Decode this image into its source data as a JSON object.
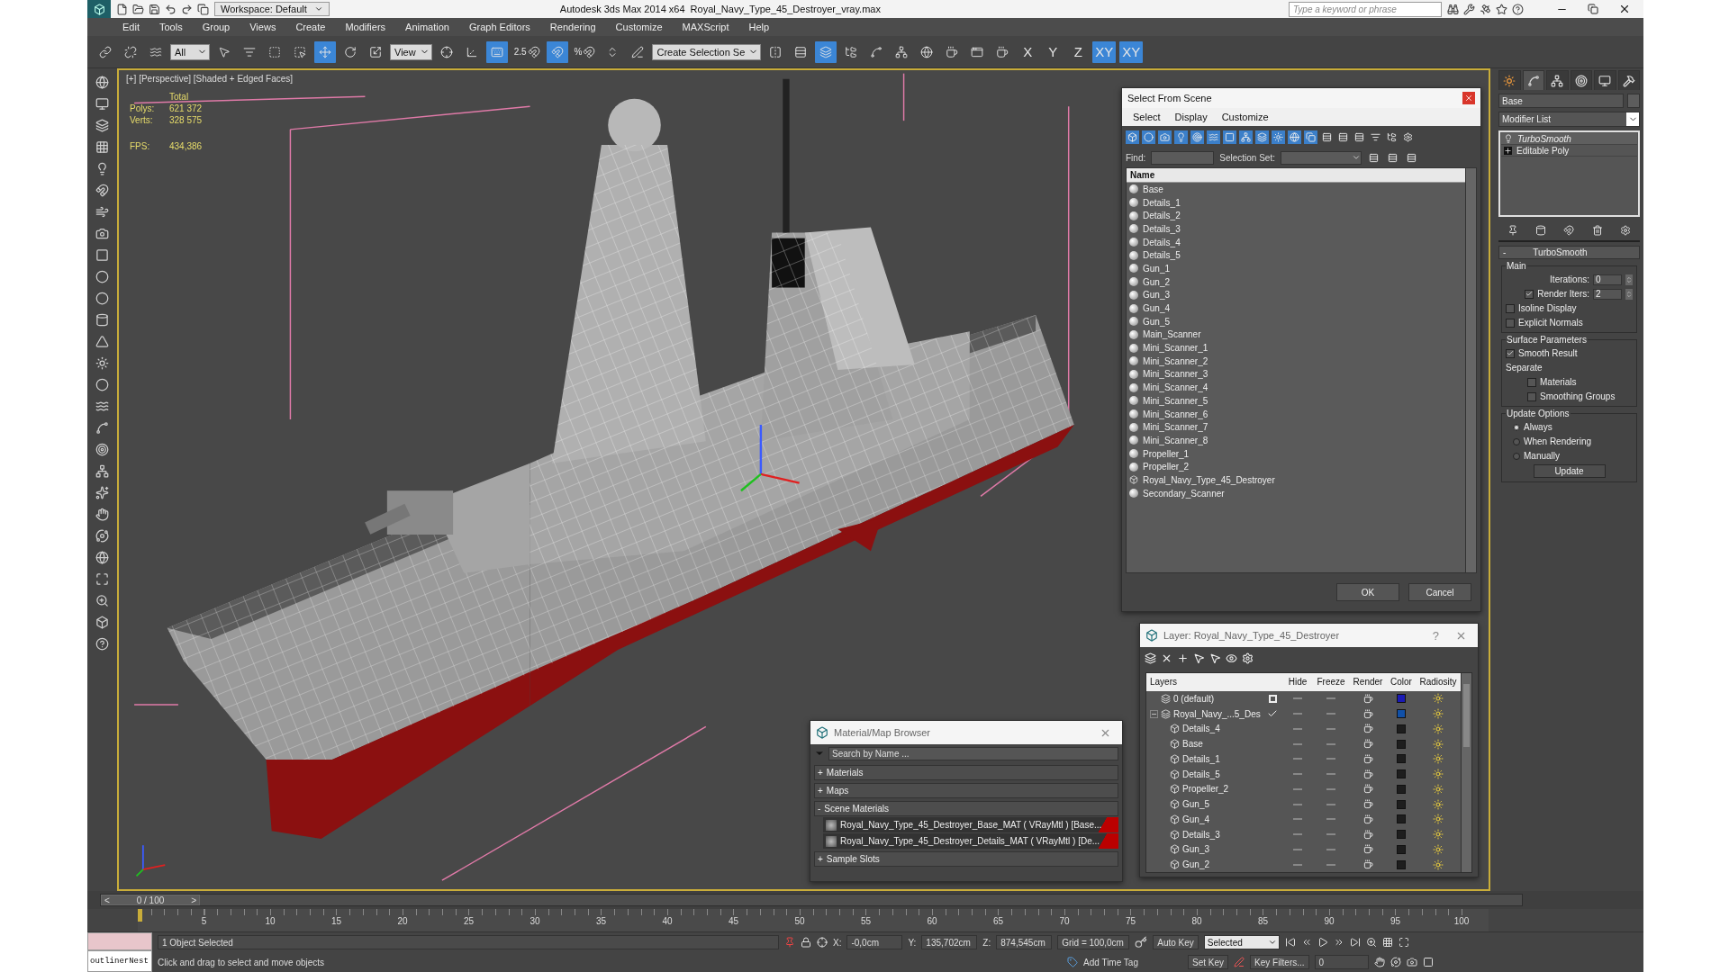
{
  "title_bar": {
    "workspace": "Workspace: Default",
    "app_title": "Autodesk 3ds Max  2014 x64",
    "file_name": "Royal_Navy_Type_45_Destroyer_vray.max",
    "search_placeholder": "Type a keyword or phrase"
  },
  "menu": [
    "Edit",
    "Tools",
    "Group",
    "Views",
    "Create",
    "Modifiers",
    "Animation",
    "Graph Editors",
    "Rendering",
    "Customize",
    "MAXScript",
    "Help"
  ],
  "toolbar": [
    {
      "kind": "link",
      "selected": false
    },
    {
      "kind": "unlink",
      "selected": false
    },
    {
      "kind": "bind",
      "selected": false
    },
    {
      "kind": "dropdown",
      "value": "All"
    },
    {
      "kind": "select",
      "selected": false
    },
    {
      "kind": "select-name",
      "selected": false
    },
    {
      "kind": "region",
      "selected": false
    },
    {
      "kind": "crossing",
      "selected": false
    },
    {
      "kind": "move",
      "selected": true
    },
    {
      "kind": "rotate",
      "selected": false
    },
    {
      "kind": "scale",
      "selected": false
    },
    {
      "kind": "dropdown",
      "value": "View"
    },
    {
      "kind": "pivot",
      "selected": false
    },
    {
      "kind": "manipulate",
      "selected": false
    },
    {
      "kind": "shortcut",
      "selected": true
    },
    {
      "kind": "snap",
      "label": "2.5",
      "selected": false
    },
    {
      "kind": "angle-snap",
      "selected": true
    },
    {
      "kind": "percent-snap",
      "label": "%",
      "selected": false
    },
    {
      "kind": "spinner-snap",
      "selected": false
    },
    {
      "kind": "named-sets",
      "selected": false
    },
    {
      "kind": "dropdown",
      "value": "Create Selection Se"
    },
    {
      "kind": "mirror",
      "selected": false
    },
    {
      "kind": "align",
      "selected": false
    },
    {
      "kind": "layers",
      "selected": true
    },
    {
      "kind": "scene",
      "selected": false
    },
    {
      "kind": "curve",
      "selected": false
    },
    {
      "kind": "schematic",
      "selected": false
    },
    {
      "kind": "material",
      "selected": false
    },
    {
      "kind": "render-setup",
      "selected": false
    },
    {
      "kind": "frame-window",
      "selected": false
    },
    {
      "kind": "render",
      "selected": false
    },
    {
      "kind": "axis",
      "label": "X",
      "selected": false
    },
    {
      "kind": "axis",
      "label": "Y",
      "selected": false
    },
    {
      "kind": "axis",
      "label": "Z",
      "selected": false
    },
    {
      "kind": "axis",
      "label": "XY",
      "selected": true
    },
    {
      "kind": "axis",
      "label": "XY",
      "selected": true
    }
  ],
  "viewport": {
    "label": "[+] [Perspective] [Shaded + Edged Faces]",
    "stats_title": "Total",
    "stats": [
      {
        "label": "Polys:",
        "value": "621 372"
      },
      {
        "label": "Verts:",
        "value": "328 575"
      }
    ],
    "fps": {
      "label": "FPS:",
      "value": "434,386"
    }
  },
  "select_from_scene": {
    "title": "Select From Scene",
    "menu": [
      "Select",
      "Display",
      "Customize"
    ],
    "find_label": "Find:",
    "selection_set_label": "Selection Set:",
    "column": "Name",
    "objects": [
      {
        "name": "Base",
        "kind": "object",
        "selected": false
      },
      {
        "name": "Details_1",
        "kind": "object",
        "selected": false
      },
      {
        "name": "Details_2",
        "kind": "object",
        "selected": false
      },
      {
        "name": "Details_3",
        "kind": "object",
        "selected": false
      },
      {
        "name": "Details_4",
        "kind": "object",
        "selected": false
      },
      {
        "name": "Details_5",
        "kind": "object",
        "selected": false
      },
      {
        "name": "Gun_1",
        "kind": "object",
        "selected": false
      },
      {
        "name": "Gun_2",
        "kind": "object",
        "selected": false
      },
      {
        "name": "Gun_3",
        "kind": "object",
        "selected": false
      },
      {
        "name": "Gun_4",
        "kind": "object",
        "selected": false
      },
      {
        "name": "Gun_5",
        "kind": "object",
        "selected": false
      },
      {
        "name": "Main_Scanner",
        "kind": "object",
        "selected": false
      },
      {
        "name": "Mini_Scanner_1",
        "kind": "object",
        "selected": false
      },
      {
        "name": "Mini_Scanner_2",
        "kind": "object",
        "selected": false
      },
      {
        "name": "Mini_Scanner_3",
        "kind": "object",
        "selected": false
      },
      {
        "name": "Mini_Scanner_4",
        "kind": "object",
        "selected": false
      },
      {
        "name": "Mini_Scanner_5",
        "kind": "object",
        "selected": false
      },
      {
        "name": "Mini_Scanner_6",
        "kind": "object",
        "selected": false
      },
      {
        "name": "Mini_Scanner_7",
        "kind": "object",
        "selected": false
      },
      {
        "name": "Mini_Scanner_8",
        "kind": "object",
        "selected": false
      },
      {
        "name": "Propeller_1",
        "kind": "object",
        "selected": false
      },
      {
        "name": "Propeller_2",
        "kind": "object",
        "selected": false
      },
      {
        "name": "Royal_Navy_Type_45_Destroyer",
        "kind": "group",
        "selected": false
      },
      {
        "name": "Secondary_Scanner",
        "kind": "object",
        "selected": false
      }
    ],
    "buttons": [
      "OK",
      "Cancel"
    ]
  },
  "layer_dialog": {
    "title": "Layer: Royal_Navy_Type_45_Destroyer",
    "help": "?",
    "columns": [
      "Layers",
      "Hide",
      "Freeze",
      "Render",
      "Color",
      "Radiosity"
    ],
    "layers": [
      {
        "name": "0 (default)",
        "current": false,
        "color": "#1a1ab4"
      },
      {
        "name": "Royal_Navy_...5_Des",
        "current": true,
        "expanded": true,
        "color": "#1050a8",
        "children": [
          {
            "name": "Details_4",
            "color": "#1e1e1e"
          },
          {
            "name": "Base",
            "color": "#1e1e1e"
          },
          {
            "name": "Details_1",
            "color": "#1e1e1e"
          },
          {
            "name": "Details_5",
            "color": "#1e1e1e"
          },
          {
            "name": "Propeller_2",
            "color": "#1e1e1e"
          },
          {
            "name": "Gun_5",
            "color": "#1e1e1e"
          },
          {
            "name": "Gun_4",
            "color": "#1e1e1e"
          },
          {
            "name": "Details_3",
            "color": "#1e1e1e"
          },
          {
            "name": "Gun_3",
            "color": "#1e1e1e"
          },
          {
            "name": "Gun_2",
            "color": "#1e1e1e"
          }
        ]
      }
    ]
  },
  "material_browser": {
    "title": "Material/Map Browser",
    "search_placeholder": "Search by Name ...",
    "sections": [
      {
        "toggle": "+",
        "label": "Materials"
      },
      {
        "toggle": "+",
        "label": "Maps"
      },
      {
        "toggle": "-",
        "label": "Scene Materials",
        "items": [
          "Royal_Navy_Type_45_Destroyer_Base_MAT ( VRayMtl ) [Base...",
          "Royal_Navy_Type_45_Destroyer_Details_MAT ( VRayMtl ) [De..."
        ]
      },
      {
        "toggle": "+",
        "label": "Sample Slots"
      }
    ]
  },
  "command_panel": {
    "tabs": [
      {
        "kind": "create",
        "selected": false
      },
      {
        "kind": "modify",
        "selected": true
      },
      {
        "kind": "hierarchy",
        "selected": false
      },
      {
        "kind": "motion",
        "selected": false
      },
      {
        "kind": "display",
        "selected": false
      },
      {
        "kind": "utilities",
        "selected": false
      }
    ],
    "object_name": "Base",
    "modifier_list": "Modifier List",
    "stack": [
      {
        "name": "TurboSmooth",
        "kind": "modifier"
      },
      {
        "name": "Editable Poly",
        "kind": "base"
      }
    ],
    "rollout": {
      "collapse": "-",
      "title": "TurboSmooth",
      "groups": [
        {
          "title": "Main",
          "controls": [
            {
              "kind": "spinner",
              "label": "Iterations:",
              "value": "0"
            },
            {
              "kind": "spinner",
              "label": "Render Iters:",
              "value": "2",
              "checked": true
            },
            {
              "kind": "checkbox",
              "label": "Isoline Display",
              "checked": false
            },
            {
              "kind": "checkbox",
              "label": "Explicit Normals",
              "checked": false
            }
          ]
        },
        {
          "title": "Surface Parameters",
          "controls": [
            {
              "kind": "checkbox",
              "label": "Smooth Result",
              "checked": true
            },
            {
              "kind": "label",
              "label": "Separate"
            },
            {
              "kind": "subcheckbox",
              "label": "Materials",
              "checked": false
            },
            {
              "kind": "subcheckbox",
              "label": "Smoothing Groups",
              "checked": false
            }
          ]
        },
        {
          "title": "Update Options",
          "controls": [
            {
              "kind": "radio",
              "label": "Always",
              "selected": true
            },
            {
              "kind": "radio",
              "label": "When Rendering",
              "selected": false
            },
            {
              "kind": "radio",
              "label": "Manually",
              "selected": false
            },
            {
              "kind": "button",
              "label": "Update"
            }
          ]
        }
      ]
    }
  },
  "time_slider": {
    "prev": "<",
    "label": "0 / 100",
    "next": ">",
    "level": 0
  },
  "trackbar": {
    "labels": [
      "5",
      "10",
      "15",
      "20",
      "25",
      "30",
      "35",
      "40",
      "45",
      "50",
      "55",
      "60",
      "65",
      "70",
      "75",
      "80",
      "85",
      "90",
      "95",
      "100"
    ]
  },
  "status": {
    "listener": "outlinerNest",
    "selection": "1 Object Selected",
    "prompt": "Click and drag to select and move objects",
    "coords": [
      {
        "label": "X:",
        "value": "-0,0cm"
      },
      {
        "label": "Y:",
        "value": "135,702cm"
      },
      {
        "label": "Z:",
        "value": "874,545cm"
      }
    ],
    "grid": "Grid = 100,0cm",
    "add_time_tag": "Add Time Tag",
    "auto_key": "Auto Key",
    "key_mode": "Selected",
    "set_key": "Set Key",
    "key_filters": "Key Filters...",
    "frame": "0"
  }
}
